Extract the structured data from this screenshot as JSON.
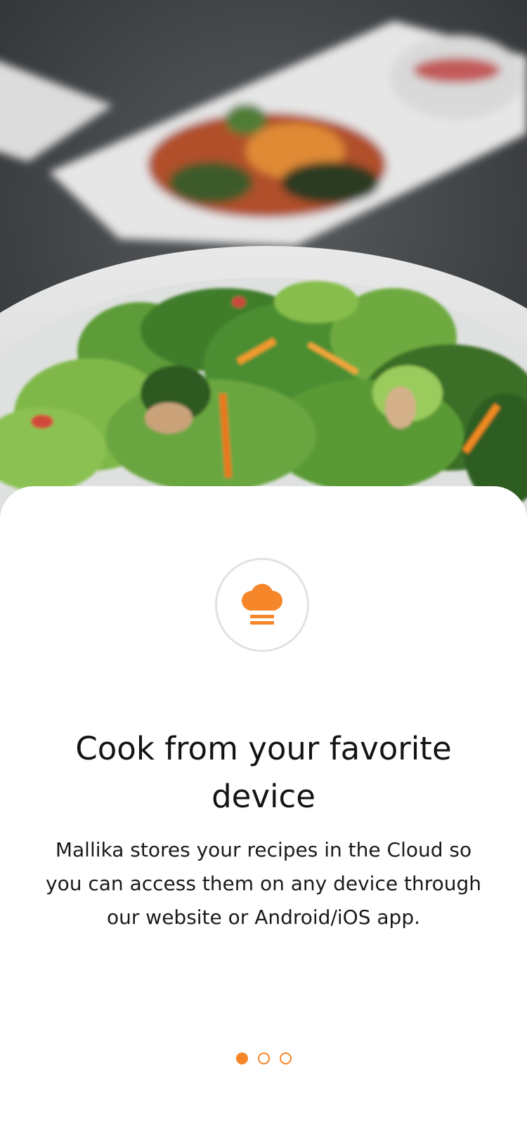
{
  "hero": {
    "image": "salad-photo",
    "alt_icon": "food-photo"
  },
  "onboarding": {
    "icon": "chef-hat-icon",
    "title": "Cook from your favorite device",
    "description": "Mallika stores your recipes in the Cloud so you can access them on any device through our website or Android/iOS app."
  },
  "pagination": {
    "total": 3,
    "current": 1
  },
  "colors": {
    "accent": "#f5862a",
    "text": "#141414",
    "circle_border": "#e2e2e2",
    "background": "#ffffff"
  }
}
